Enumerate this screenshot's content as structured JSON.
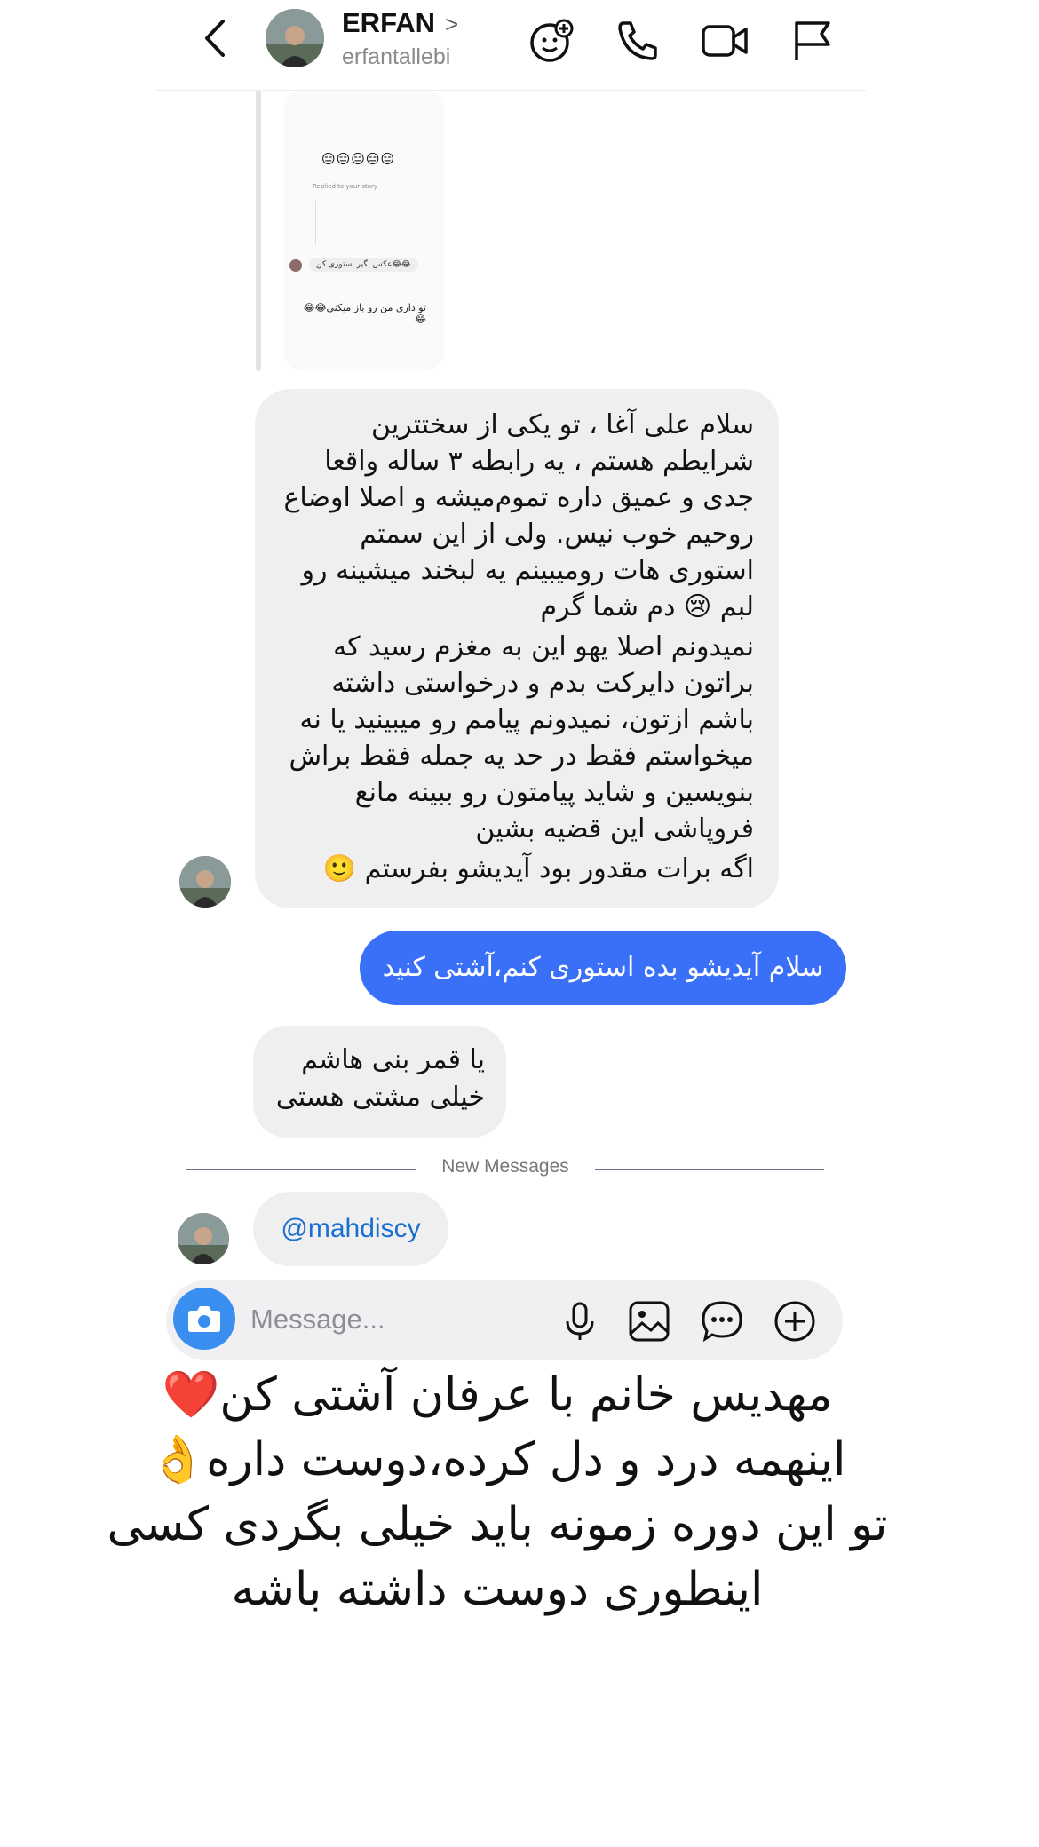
{
  "header": {
    "name": "ERFAN",
    "username": "erfantallebi",
    "icons": [
      "back-chevron-icon",
      "effects-icon",
      "phone-icon",
      "video-icon",
      "flag-icon"
    ]
  },
  "reply_preview": {
    "emoji_row": "😑😑😑😑😑",
    "caption_line": "Replied to your story",
    "pill": "عکس بگیر استوری کن😂😂",
    "bottom_text": "تو داری من رو باز میکنی😂😂😂"
  },
  "messages": [
    {
      "direction": "incoming",
      "paragraphs": [
        "سلام علی آغا ، تو یکی از سختترین شرایطم هستم ، یه رابطه ۳ ساله واقعا جدی و عمیق داره تموم‌میشه و اصلا اوضاع روحیم خوب نیس.  ولی از این سمتم استوری هات رومیبینم یه لبخند میشینه رو لبم 😢 دم شما گرم",
        "نمیدونم اصلا یهو این به مغزم رسید که براتون دایرکت بدم و درخواستی داشته باشم ازتون، نمیدونم پیامم رو میبینید یا نه میخواستم فقط در حد یه جمله فقط براش بنویسین و شاید پیامتون رو ببینه مانع فروپاشی این قضیه بشین",
        "اگه برات مقدور بود آیدیشو بفرستم 🙂"
      ]
    },
    {
      "direction": "outgoing",
      "text": "سلام آیدیشو بده استوری کنم،آشتی کنید"
    },
    {
      "direction": "incoming",
      "lines": [
        "یا قمر بنی هاشم",
        "خیلی مشتی هستی"
      ]
    },
    {
      "direction": "incoming",
      "text": "@mahdiscy"
    }
  ],
  "divider_label": "New Messages",
  "composer": {
    "placeholder": "Message...",
    "icons": [
      "camera-icon",
      "microphone-icon",
      "gallery-icon",
      "sticker-icon",
      "plus-icon"
    ]
  },
  "caption": {
    "lines": [
      "مهدیس خانم با عرفان آشتی کن❤️",
      "اینهمه درد و دل کرده،دوست داره👌",
      "تو این دوره زمونه باید خیلی بگردی کسی",
      "اینطوری دوست داشته باشه"
    ]
  },
  "colors": {
    "outgoing_bubble": "#3a6ff7",
    "incoming_bubble": "#efefef",
    "mention": "#1a6fd0",
    "camera_button": "#3a8ef0"
  }
}
